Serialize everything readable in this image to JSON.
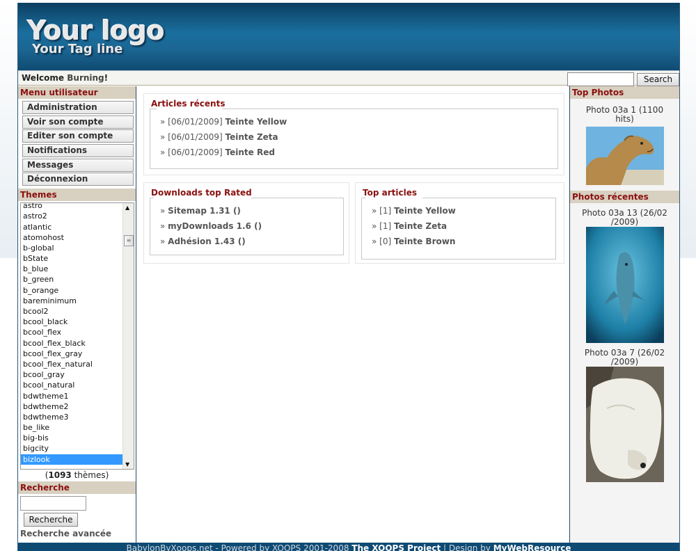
{
  "header": {
    "logo": "Your logo",
    "tagline": "Your Tag line"
  },
  "welcome": {
    "prefix": "Welcome ",
    "user": "Burning",
    "suffix": "!"
  },
  "search": {
    "button": "Search"
  },
  "menu": {
    "title": "Menu utilisateur",
    "items": [
      {
        "label": "Administration"
      },
      {
        "label": "Voir son compte"
      },
      {
        "label": "Editer son compte"
      },
      {
        "label": "Notifications"
      },
      {
        "label": "Messages"
      },
      {
        "label": "Déconnexion"
      }
    ]
  },
  "themes": {
    "title": "Themes",
    "list": [
      "astro",
      "astro2",
      "atlantic",
      "atomohost",
      "b-global",
      "bState",
      "b_blue",
      "b_green",
      "b_orange",
      "bareminimum",
      "bcool2",
      "bcool_black",
      "bcool_flex",
      "bcool_flex_black",
      "bcool_flex_gray",
      "bcool_flex_natural",
      "bcool_gray",
      "bcool_natural",
      "bdwtheme1",
      "bdwtheme2",
      "bdwtheme3",
      "be_like",
      "big-bis",
      "bigcity",
      "bizlook"
    ],
    "selected": "bizlook",
    "count": "1093",
    "count_suffix": " thèmes"
  },
  "recherche": {
    "title": "Recherche",
    "button": "Recherche",
    "advanced": "Recherche avancée"
  },
  "articles_recents": {
    "title": "Articles récents",
    "items": [
      {
        "date": "[06/01/2009]",
        "title": "Teinte Yellow"
      },
      {
        "date": "[06/01/2009]",
        "title": "Teinte Zeta"
      },
      {
        "date": "[06/01/2009]",
        "title": "Teinte Red"
      }
    ]
  },
  "downloads": {
    "title": "Downloads top Rated",
    "items": [
      {
        "label": "Sitemap 1.31 ()"
      },
      {
        "label": "myDownloads 1.6 ()"
      },
      {
        "label": "Adhésion 1.43 ()"
      }
    ]
  },
  "top_articles": {
    "title": "Top articles",
    "items": [
      {
        "rank": "[1]",
        "title": "Teinte Yellow"
      },
      {
        "rank": "[1]",
        "title": "Teinte Zeta"
      },
      {
        "rank": "[0]",
        "title": "Teinte Brown"
      }
    ]
  },
  "top_photos": {
    "title": "Top Photos",
    "caption_line1": "Photo 03a 1 (1100",
    "caption_line2": "hits)"
  },
  "recent_photos": {
    "title": "Photos récentes",
    "photo1_line1": "Photo 03a 13 (26/02",
    "photo1_line2": "/2009)",
    "photo2_line1": "Photo 03a 7 (26/02",
    "photo2_line2": "/2009)"
  },
  "footer": {
    "text": "BabylonByXoops.net - Powered by XOOPS 2001-2008 ",
    "project": "The XOOPS Project",
    "sep": " | Design by ",
    "design": "MyWebResource"
  }
}
